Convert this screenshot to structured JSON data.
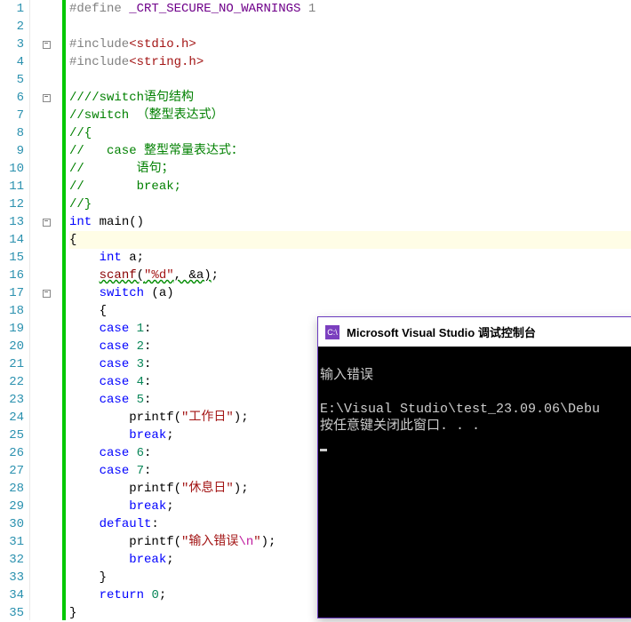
{
  "editor": {
    "lineCount": 35,
    "foldMarkers": {
      "3": "-",
      "6": "-",
      "13": "-",
      "17": "-"
    },
    "highlightLine": 14,
    "tokens": {
      "l1": [
        {
          "t": "#define ",
          "c": "preproc"
        },
        {
          "t": "_CRT_SECURE_NO_WARNINGS",
          "c": "macro"
        },
        {
          "t": " 1",
          "c": "preproc"
        }
      ],
      "l2": [],
      "l3": [
        {
          "t": "#include",
          "c": "preproc"
        },
        {
          "t": "<stdio.h>",
          "c": "string"
        }
      ],
      "l4": [
        {
          "t": "#include",
          "c": "preproc"
        },
        {
          "t": "<string.h>",
          "c": "string"
        }
      ],
      "l5": [],
      "l6": [
        {
          "t": "////switch语句结构",
          "c": "comment"
        }
      ],
      "l7": [
        {
          "t": "//switch （整型表达式）",
          "c": "comment"
        }
      ],
      "l8": [
        {
          "t": "//{",
          "c": "comment"
        }
      ],
      "l9": [
        {
          "t": "//   case 整型常量表达式：",
          "c": "comment"
        }
      ],
      "l10": [
        {
          "t": "//       语句；",
          "c": "comment"
        }
      ],
      "l11": [
        {
          "t": "//       break;",
          "c": "comment"
        }
      ],
      "l12": [
        {
          "t": "//}",
          "c": "comment"
        }
      ],
      "l13": [
        {
          "t": "int",
          "c": "type"
        },
        {
          "t": " main",
          "c": "text-black"
        },
        {
          "t": "()",
          "c": "text-black"
        }
      ],
      "l14": [
        {
          "t": "{",
          "c": "text-black"
        }
      ],
      "l15": [
        {
          "t": "    ",
          "c": ""
        },
        {
          "t": "int",
          "c": "type"
        },
        {
          "t": " a;",
          "c": "text-black"
        }
      ],
      "l16": [
        {
          "t": "    ",
          "c": ""
        },
        {
          "t": "scanf",
          "c": "func",
          "sq": true
        },
        {
          "t": "(",
          "c": "text-black",
          "sq": true
        },
        {
          "t": "\"%d\"",
          "c": "string",
          "sq": true
        },
        {
          "t": ", &a)",
          "c": "text-black",
          "sq": true
        },
        {
          "t": ";",
          "c": "text-black"
        }
      ],
      "l17": [
        {
          "t": "    ",
          "c": ""
        },
        {
          "t": "switch",
          "c": "keyword"
        },
        {
          "t": " (a)",
          "c": "text-black"
        }
      ],
      "l18": [
        {
          "t": "    {",
          "c": "text-black"
        }
      ],
      "l19": [
        {
          "t": "    ",
          "c": ""
        },
        {
          "t": "case",
          "c": "keyword"
        },
        {
          "t": " ",
          "c": ""
        },
        {
          "t": "1",
          "c": "num"
        },
        {
          "t": ":",
          "c": "text-black"
        }
      ],
      "l20": [
        {
          "t": "    ",
          "c": ""
        },
        {
          "t": "case",
          "c": "keyword"
        },
        {
          "t": " ",
          "c": ""
        },
        {
          "t": "2",
          "c": "num"
        },
        {
          "t": ":",
          "c": "text-black"
        }
      ],
      "l21": [
        {
          "t": "    ",
          "c": ""
        },
        {
          "t": "case",
          "c": "keyword"
        },
        {
          "t": " ",
          "c": ""
        },
        {
          "t": "3",
          "c": "num"
        },
        {
          "t": ":",
          "c": "text-black"
        }
      ],
      "l22": [
        {
          "t": "    ",
          "c": ""
        },
        {
          "t": "case",
          "c": "keyword"
        },
        {
          "t": " ",
          "c": ""
        },
        {
          "t": "4",
          "c": "num"
        },
        {
          "t": ":",
          "c": "text-black"
        }
      ],
      "l23": [
        {
          "t": "    ",
          "c": ""
        },
        {
          "t": "case",
          "c": "keyword"
        },
        {
          "t": " ",
          "c": ""
        },
        {
          "t": "5",
          "c": "num"
        },
        {
          "t": ":",
          "c": "text-black"
        }
      ],
      "l24": [
        {
          "t": "        printf",
          "c": "text-black"
        },
        {
          "t": "(",
          "c": "text-black"
        },
        {
          "t": "\"工作日\"",
          "c": "string"
        },
        {
          "t": ");",
          "c": "text-black"
        }
      ],
      "l25": [
        {
          "t": "        ",
          "c": ""
        },
        {
          "t": "break",
          "c": "keyword"
        },
        {
          "t": ";",
          "c": "text-black"
        }
      ],
      "l26": [
        {
          "t": "    ",
          "c": ""
        },
        {
          "t": "case",
          "c": "keyword"
        },
        {
          "t": " ",
          "c": ""
        },
        {
          "t": "6",
          "c": "num"
        },
        {
          "t": ":",
          "c": "text-black"
        }
      ],
      "l27": [
        {
          "t": "    ",
          "c": ""
        },
        {
          "t": "case",
          "c": "keyword"
        },
        {
          "t": " ",
          "c": ""
        },
        {
          "t": "7",
          "c": "num"
        },
        {
          "t": ":",
          "c": "text-black"
        }
      ],
      "l28": [
        {
          "t": "        printf",
          "c": "text-black"
        },
        {
          "t": "(",
          "c": "text-black"
        },
        {
          "t": "\"休息日\"",
          "c": "string"
        },
        {
          "t": ");",
          "c": "text-black"
        }
      ],
      "l29": [
        {
          "t": "        ",
          "c": ""
        },
        {
          "t": "break",
          "c": "keyword"
        },
        {
          "t": ";",
          "c": "text-black"
        }
      ],
      "l30": [
        {
          "t": "    ",
          "c": ""
        },
        {
          "t": "default",
          "c": "keyword"
        },
        {
          "t": ":",
          "c": "text-black"
        }
      ],
      "l31": [
        {
          "t": "        printf",
          "c": "text-black"
        },
        {
          "t": "(",
          "c": "text-black"
        },
        {
          "t": "\"输入错误",
          "c": "string"
        },
        {
          "t": "\\n",
          "c": "escape"
        },
        {
          "t": "\"",
          "c": "string"
        },
        {
          "t": ");",
          "c": "text-black"
        }
      ],
      "l32": [
        {
          "t": "        ",
          "c": ""
        },
        {
          "t": "break",
          "c": "keyword"
        },
        {
          "t": ";",
          "c": "text-black"
        }
      ],
      "l33": [
        {
          "t": "    }",
          "c": "text-black"
        }
      ],
      "l34": [
        {
          "t": "    ",
          "c": ""
        },
        {
          "t": "return",
          "c": "keyword"
        },
        {
          "t": " ",
          "c": ""
        },
        {
          "t": "0",
          "c": "num"
        },
        {
          "t": ";",
          "c": "text-black"
        }
      ],
      "l35": [
        {
          "t": "}",
          "c": "text-black"
        }
      ]
    }
  },
  "console": {
    "iconText": "C:\\",
    "title": "Microsoft Visual Studio 调试控制台",
    "lines": [
      "",
      "输入错误",
      "",
      "E:\\Visual Studio\\test_23.09.06\\Debu",
      "按任意键关闭此窗口. . ."
    ]
  }
}
